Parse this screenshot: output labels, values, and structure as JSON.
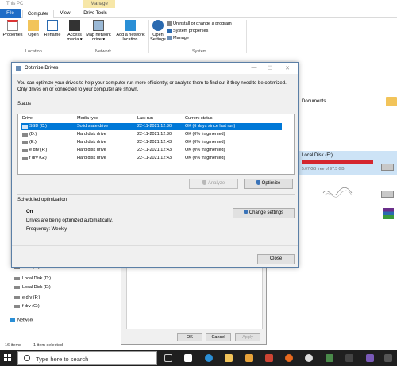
{
  "explorer": {
    "window_title": "This PC",
    "manage_tab": "Manage",
    "tabs": [
      "File",
      "Computer",
      "View",
      "Drive Tools"
    ],
    "ribbon": {
      "location_buttons": [
        "Properties",
        "Open",
        "Rename"
      ],
      "network_buttons": [
        "Access media ▾",
        "Map network drive ▾",
        "Add a network location"
      ],
      "open_settings": "Open Settings",
      "system_items": [
        "Uninstall or change a program",
        "System properties",
        "Manage"
      ],
      "groups": [
        "Location",
        "Network",
        "System"
      ]
    },
    "nav_drives": [
      "SSD (C:)",
      "Local Disk (D:)",
      "Local Disk (E:)",
      "e drv (F:)",
      "f drv (G:)"
    ],
    "nav_network": "Network",
    "status_count": "16 items",
    "status_selected": "1 item selected",
    "content": {
      "documents": "Documents",
      "local_disk_e": "Local Disk (E:)",
      "local_disk_e_free": "5.07 GB free of 97.5 GB",
      "local_disk_e_used_fraction": 0.95
    }
  },
  "properties_dialog": {
    "buttons": [
      "OK",
      "Cancel",
      "Apply"
    ]
  },
  "optimize_dialog": {
    "title": "Optimize Drives",
    "window_controls": [
      "—",
      "☐",
      "✕"
    ],
    "intro": "You can optimize your drives to help your computer run more efficiently, or analyze them to find out if they need to be optimized. Only drives on or connected to your computer are shown.",
    "status_heading": "Status",
    "columns": [
      "Drive",
      "Media type",
      "Last run",
      "Current status"
    ],
    "drives": [
      {
        "drive": "SSD (C:)",
        "media": "Solid state drive",
        "last_run": "22-11-2021 12:30",
        "status": "OK (6 days since last run)",
        "selected": true
      },
      {
        "drive": "(D:)",
        "media": "Hard disk drive",
        "last_run": "22-11-2021 12:30",
        "status": "OK (0% fragmented)",
        "selected": false
      },
      {
        "drive": "(E:)",
        "media": "Hard disk drive",
        "last_run": "22-11-2021 12:43",
        "status": "OK (0% fragmented)",
        "selected": false
      },
      {
        "drive": "e drv (F:)",
        "media": "Hard disk drive",
        "last_run": "22-11-2021 12:43",
        "status": "OK (0% fragmented)",
        "selected": false
      },
      {
        "drive": "f drv (G:)",
        "media": "Hard disk drive",
        "last_run": "22-11-2021 12:43",
        "status": "OK (0% fragmented)",
        "selected": false
      }
    ],
    "analyze_label": "Analyze",
    "optimize_label": "Optimize",
    "scheduled_heading": "Scheduled optimization",
    "scheduled_state": "On",
    "scheduled_desc": "Drives are being optimized automatically.",
    "frequency": "Frequency: Weekly",
    "change_settings_label": "Change settings",
    "close_label": "Close"
  },
  "taskbar": {
    "search_placeholder": "Type here to search"
  },
  "colors": {
    "selection": "#0078d7",
    "file_tab": "#1e6dc7",
    "disk_full": "#d4262f",
    "taskbar": "#1f1f1f"
  }
}
